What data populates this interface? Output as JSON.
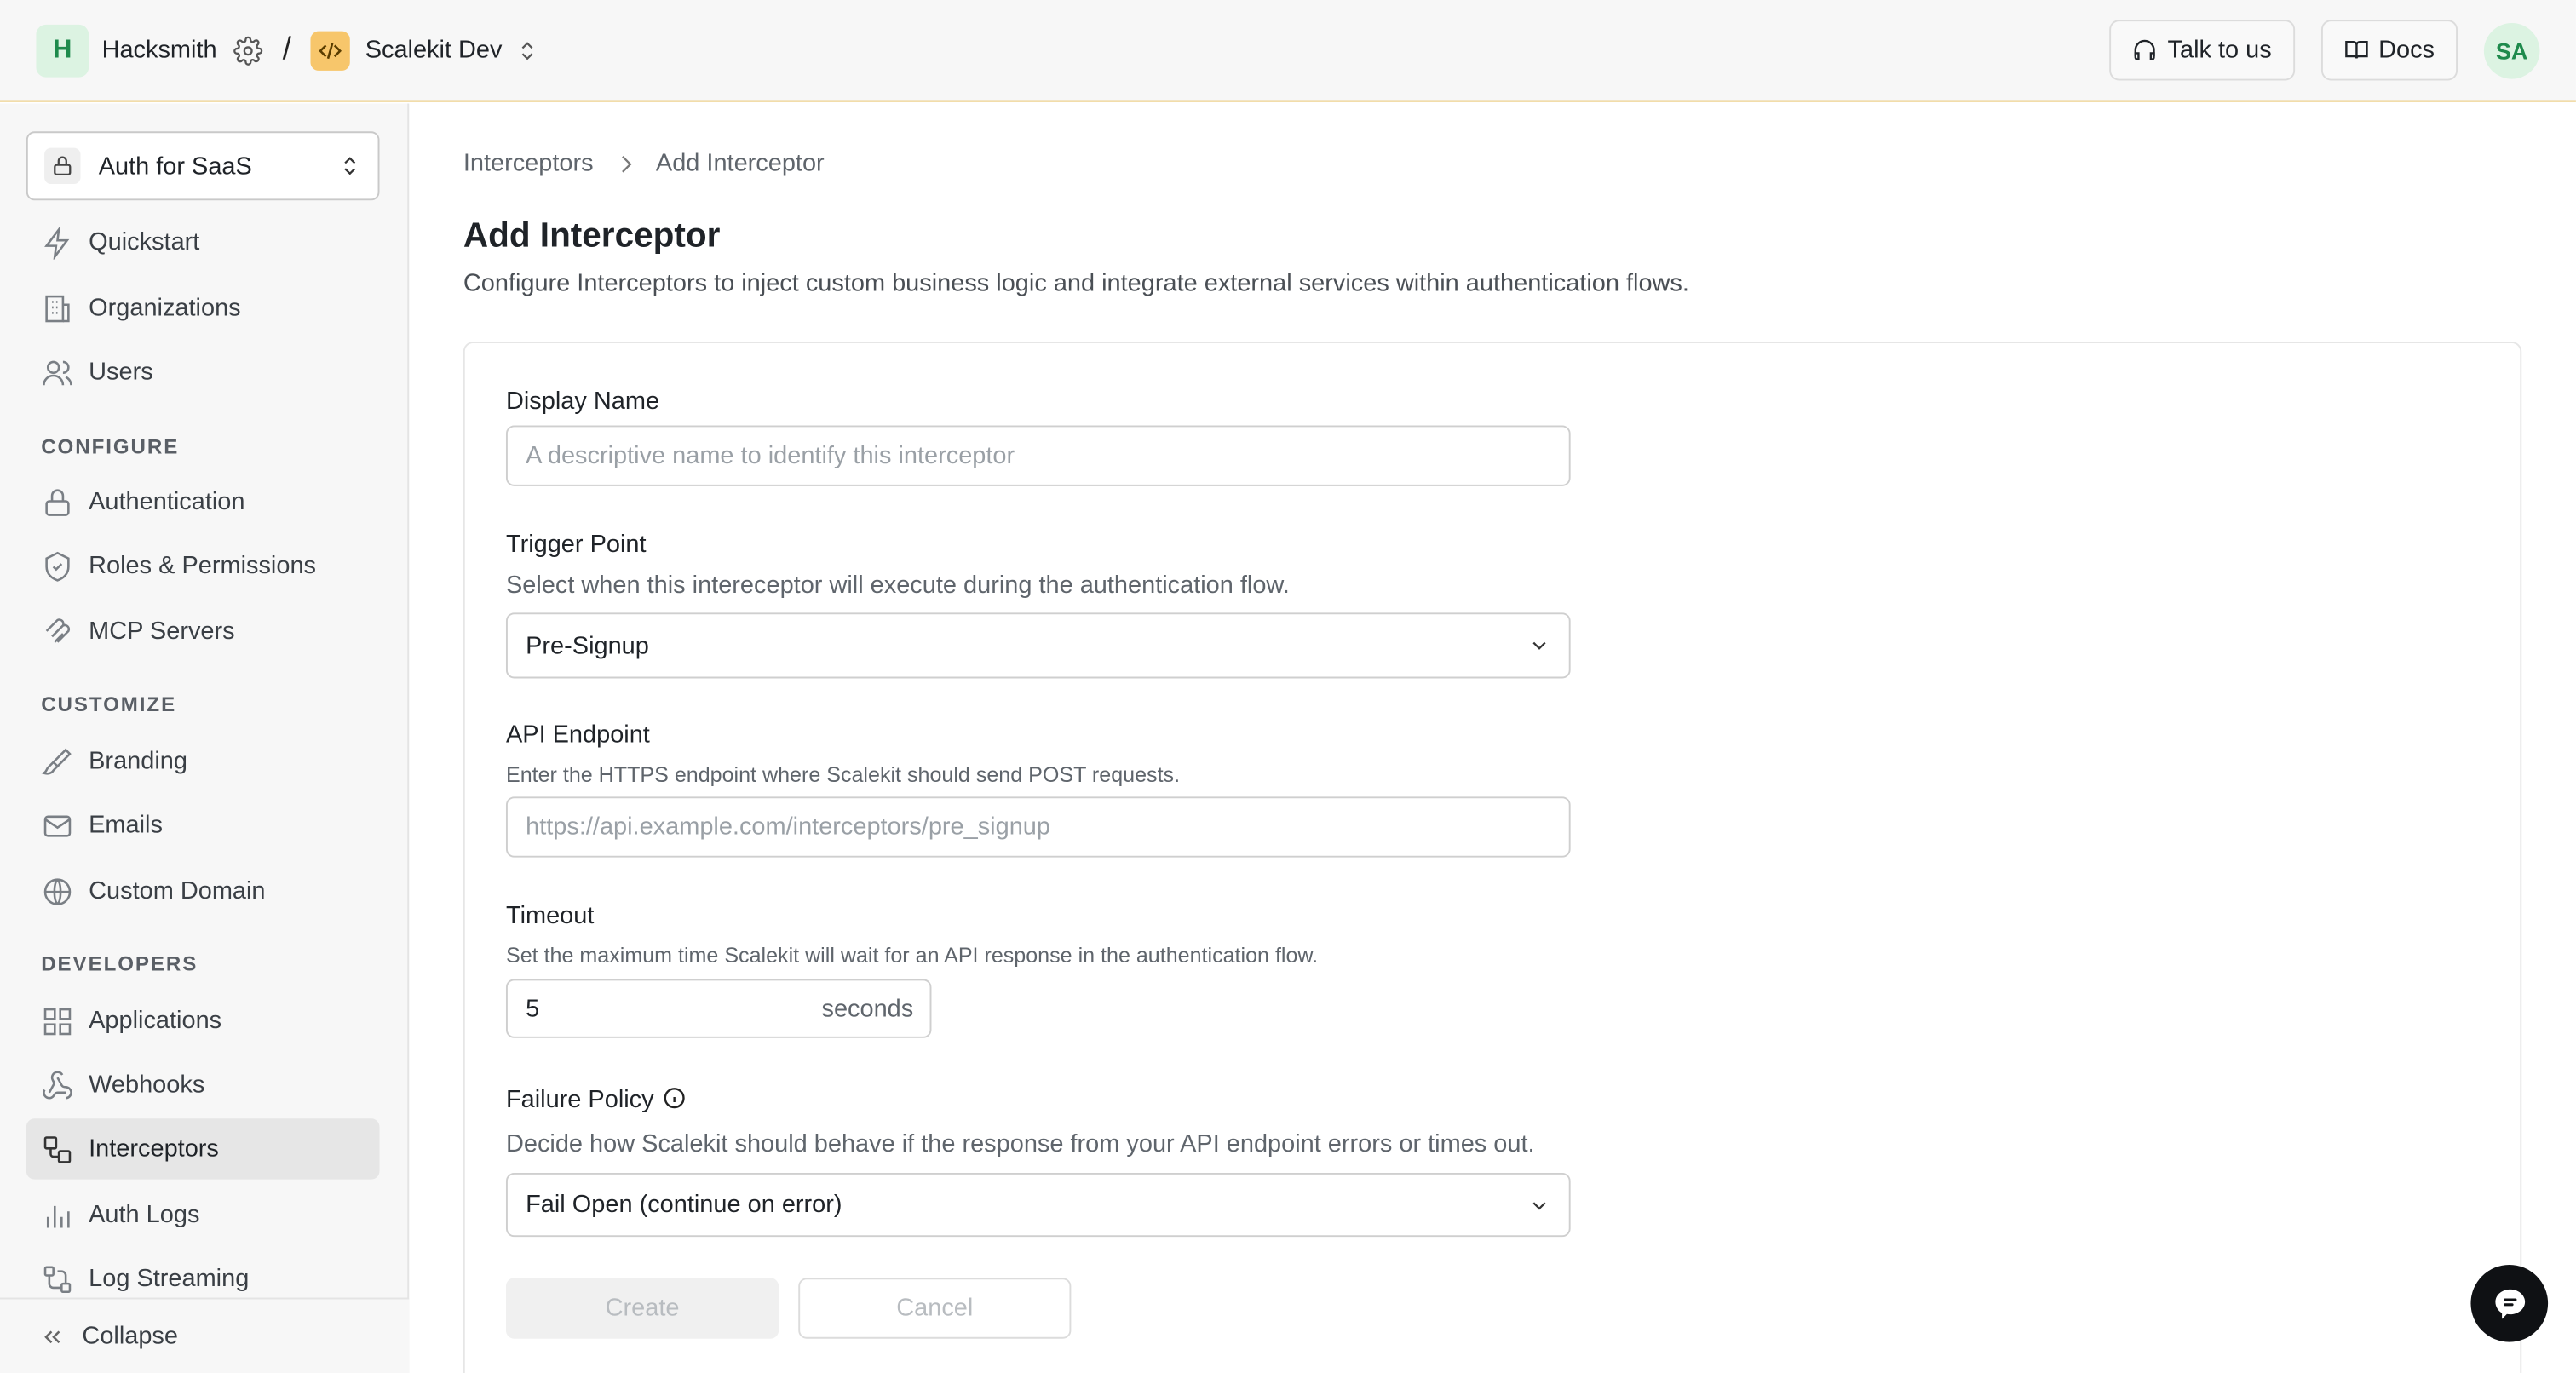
{
  "header": {
    "workspace_initial": "H",
    "workspace_name": "Hacksmith",
    "separator": "/",
    "environment_name": "Scalekit Dev",
    "talk_label": "Talk to us",
    "docs_label": "Docs",
    "avatar_initials": "SA"
  },
  "sidebar": {
    "app_selector": "Auth for SaaS",
    "items_top": [
      {
        "label": "Quickstart",
        "icon": "bolt-icon"
      },
      {
        "label": "Organizations",
        "icon": "building-icon"
      },
      {
        "label": "Users",
        "icon": "users-icon"
      }
    ],
    "section_configure": "CONFIGURE",
    "items_configure": [
      {
        "label": "Authentication",
        "icon": "lock-icon"
      },
      {
        "label": "Roles & Permissions",
        "icon": "shield-icon"
      },
      {
        "label": "MCP Servers",
        "icon": "mcp-icon"
      }
    ],
    "section_customize": "CUSTOMIZE",
    "items_customize": [
      {
        "label": "Branding",
        "icon": "brush-icon"
      },
      {
        "label": "Emails",
        "icon": "mail-icon"
      },
      {
        "label": "Custom Domain",
        "icon": "globe-icon"
      }
    ],
    "section_developers": "DEVELOPERS",
    "items_developers": [
      {
        "label": "Applications",
        "icon": "grid-icon"
      },
      {
        "label": "Webhooks",
        "icon": "webhook-icon"
      },
      {
        "label": "Interceptors",
        "icon": "interceptor-icon",
        "active": true
      },
      {
        "label": "Auth Logs",
        "icon": "bars-icon"
      },
      {
        "label": "Log Streaming",
        "icon": "stream-icon"
      }
    ],
    "collapse_label": "Collapse"
  },
  "main": {
    "breadcrumb": [
      "Interceptors",
      "Add Interceptor"
    ],
    "title": "Add Interceptor",
    "description": "Configure Interceptors to inject custom business logic and integrate external services within authentication flows.",
    "form": {
      "display_name_label": "Display Name",
      "display_name_placeholder": "A descriptive name to identify this interceptor",
      "trigger_label": "Trigger Point",
      "trigger_help": "Select when this intereceptor will execute during the authentication flow.",
      "trigger_value": "Pre-Signup",
      "endpoint_label": "API Endpoint",
      "endpoint_help": "Enter the HTTPS endpoint where Scalekit should send POST requests.",
      "endpoint_placeholder": "https://api.example.com/interceptors/pre_signup",
      "timeout_label": "Timeout",
      "timeout_help": "Set the maximum time Scalekit will wait for an API response in the authentication flow.",
      "timeout_value": "5",
      "timeout_unit": "seconds",
      "failure_label": "Failure Policy",
      "failure_help": "Decide how Scalekit should behave if the response from your API endpoint errors or times out.",
      "failure_value": "Fail Open (continue on error)",
      "create_label": "Create",
      "cancel_label": "Cancel"
    }
  },
  "colors": {
    "accent_border": "#e9c46a",
    "workspace_badge": "#dcf3e2",
    "env_badge": "#f7c66b"
  }
}
